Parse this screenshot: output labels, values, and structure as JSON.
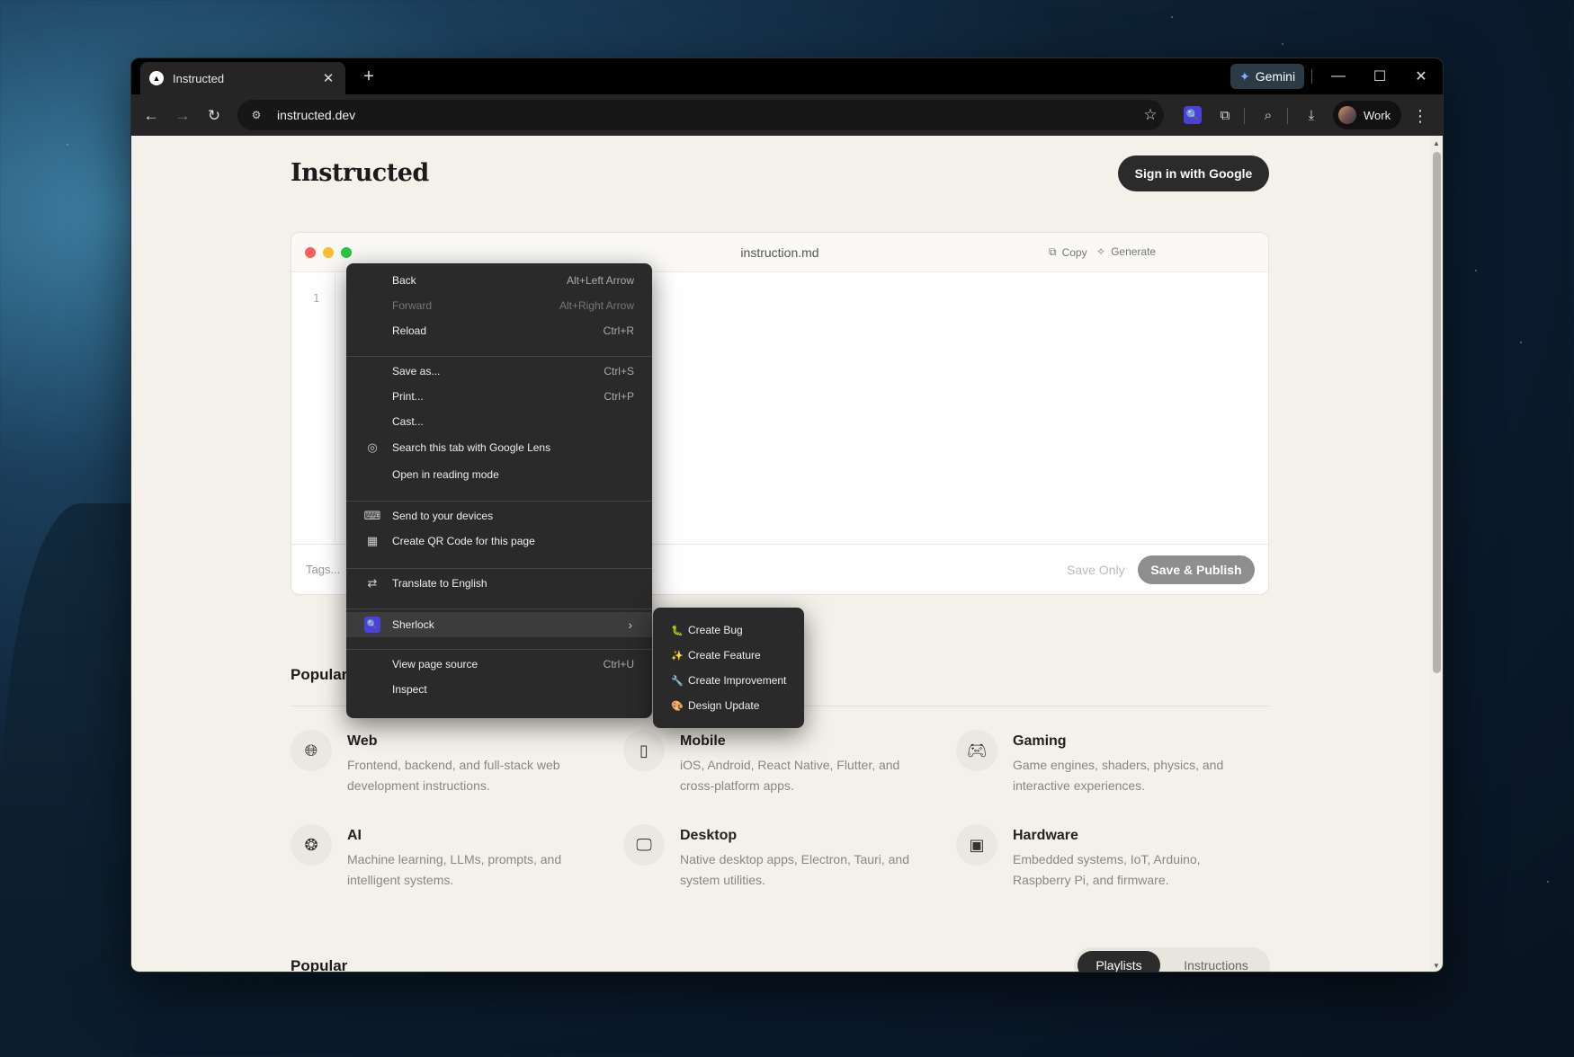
{
  "browser": {
    "tab_title": "Instructed",
    "tab_favicon": "▲",
    "url": "instructed.dev",
    "gemini_label": "Gemini",
    "profile_label": "Work"
  },
  "page": {
    "logo": "Instructed",
    "signin_label": "Sign in with Google"
  },
  "editor": {
    "filename": "instruction.md",
    "copy_label": "Copy",
    "generate_label": "Generate",
    "line_number": "1",
    "tags_placeholder": "Tags...",
    "save_only_label": "Save Only",
    "publish_label": "Save & Publish"
  },
  "sections": {
    "popular_categories": "Popular",
    "popular": "Popular"
  },
  "categories": [
    {
      "name": "Web",
      "desc": "Frontend, backend, and full-stack web development instructions.",
      "icon": "globe-icon"
    },
    {
      "name": "Mobile",
      "desc": "iOS, Android, React Native, Flutter, and cross-platform apps.",
      "icon": "phone-icon"
    },
    {
      "name": "Gaming",
      "desc": "Game engines, shaders, physics, and interactive experiences.",
      "icon": "gamepad-icon"
    },
    {
      "name": "AI",
      "desc": "Machine learning, LLMs, prompts, and intelligent systems.",
      "icon": "brain-icon"
    },
    {
      "name": "Desktop",
      "desc": "Native desktop apps, Electron, Tauri, and system utilities.",
      "icon": "monitor-icon"
    },
    {
      "name": "Hardware",
      "desc": "Embedded systems, IoT, Arduino, Raspberry Pi, and firmware.",
      "icon": "chip-icon"
    }
  ],
  "toggle": {
    "playlists": "Playlists",
    "instructions": "Instructions"
  },
  "context_menu": {
    "items": [
      {
        "label": "Back",
        "shortcut": "Alt+Left Arrow"
      },
      {
        "label": "Forward",
        "shortcut": "Alt+Right Arrow"
      },
      {
        "label": "Reload",
        "shortcut": "Ctrl+R"
      },
      {
        "label": "Save as...",
        "shortcut": "Ctrl+S"
      },
      {
        "label": "Print...",
        "shortcut": "Ctrl+P"
      },
      {
        "label": "Cast..."
      },
      {
        "label": "Search this tab with Google Lens"
      },
      {
        "label": "Open in reading mode"
      },
      {
        "label": "Send to your devices"
      },
      {
        "label": "Create QR Code for this page"
      },
      {
        "label": "Translate to English"
      },
      {
        "label": "Sherlock"
      },
      {
        "label": "View page source",
        "shortcut": "Ctrl+U"
      },
      {
        "label": "Inspect"
      }
    ]
  },
  "submenu": {
    "items": [
      {
        "label": "Create Bug",
        "icon": "🐛"
      },
      {
        "label": "Create Feature",
        "icon": "✨"
      },
      {
        "label": "Create Improvement",
        "icon": "🔧"
      },
      {
        "label": "Design Update",
        "icon": "🎨"
      }
    ]
  },
  "colors": {
    "page_bg": "#f4f0ea",
    "accent_sherlock": "#4a42d6",
    "dot_red": "#ff5f57",
    "dot_yellow": "#febc2e",
    "dot_green": "#28c840"
  }
}
